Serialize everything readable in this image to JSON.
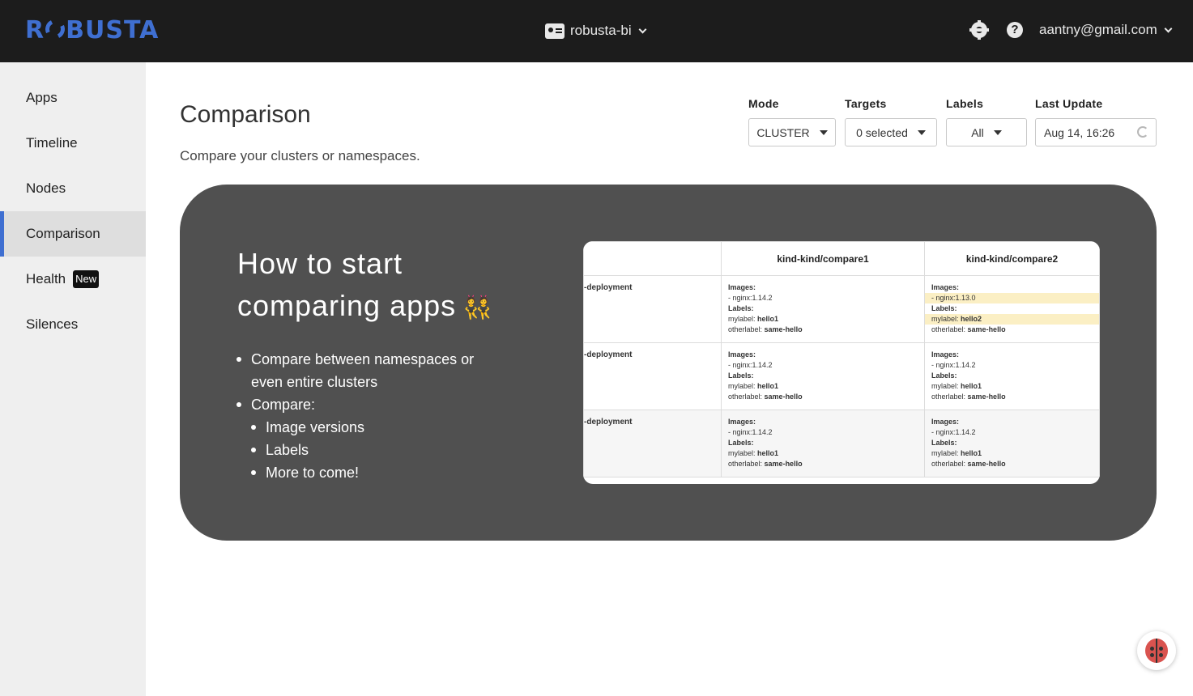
{
  "app": {
    "logo_text": "ROBUSTA"
  },
  "topbar": {
    "account_name": "robusta-bi",
    "user_email": "aantny@gmail.com",
    "icons": {
      "account": "id-card-icon",
      "settings": "gear-icon",
      "help": "help-circle-icon"
    }
  },
  "sidebar": {
    "items": [
      {
        "label": "Apps"
      },
      {
        "label": "Timeline"
      },
      {
        "label": "Nodes"
      },
      {
        "label": "Comparison",
        "active": true
      },
      {
        "label": "Health",
        "badge": "New"
      },
      {
        "label": "Silences"
      }
    ]
  },
  "main": {
    "title": "Comparison",
    "subtitle": "Compare your clusters or namespaces.",
    "filters": {
      "mode": {
        "label": "Mode",
        "value": "CLUSTER"
      },
      "targets": {
        "label": "Targets",
        "value": "0 selected"
      },
      "labels": {
        "label": "Labels",
        "value": "All"
      },
      "last_update": {
        "label": "Last Update",
        "value": "Aug 14, 16:26"
      }
    }
  },
  "banner": {
    "title_line1": "How to start",
    "title_line2": "comparing apps",
    "title_emoji": "👯",
    "bullets": [
      "Compare between namespaces or",
      "even entire clusters",
      "Compare:",
      "Image versions",
      "Labels",
      "More to come!"
    ],
    "preview": {
      "columns": [
        "",
        "kind-kind/compare1",
        "kind-kind/compare2"
      ],
      "images_label": "Images:",
      "labels_label": "Labels:",
      "mylabel_key": "mylabel:",
      "otherlabel_key": "otherlabel:",
      "rows": [
        {
          "name": "-deployment",
          "c1_image": "- nginx:1.14.2",
          "c1_mylabel": "hello1",
          "c1_other": "same-hello",
          "c2_image": "- nginx:1.13.0",
          "c2_mylabel": "hello2",
          "c2_other": "same-hello"
        },
        {
          "name": "-deployment",
          "c1_image": "- nginx:1.14.2",
          "c1_mylabel": "hello1",
          "c1_other": "same-hello",
          "c2_image": "- nginx:1.14.2",
          "c2_mylabel": "hello1",
          "c2_other": "same-hello"
        },
        {
          "name": "-deployment",
          "c1_image": "- nginx:1.14.2",
          "c1_mylabel": "hello1",
          "c1_other": "same-hello",
          "c2_image": "- nginx:1.14.2",
          "c2_mylabel": "hello1",
          "c2_other": "same-hello"
        }
      ]
    }
  },
  "colors": {
    "brand": "#3f6fd1",
    "topbar": "#1c1c1c",
    "banner": "#505050",
    "highlight": "#fbefc4"
  }
}
